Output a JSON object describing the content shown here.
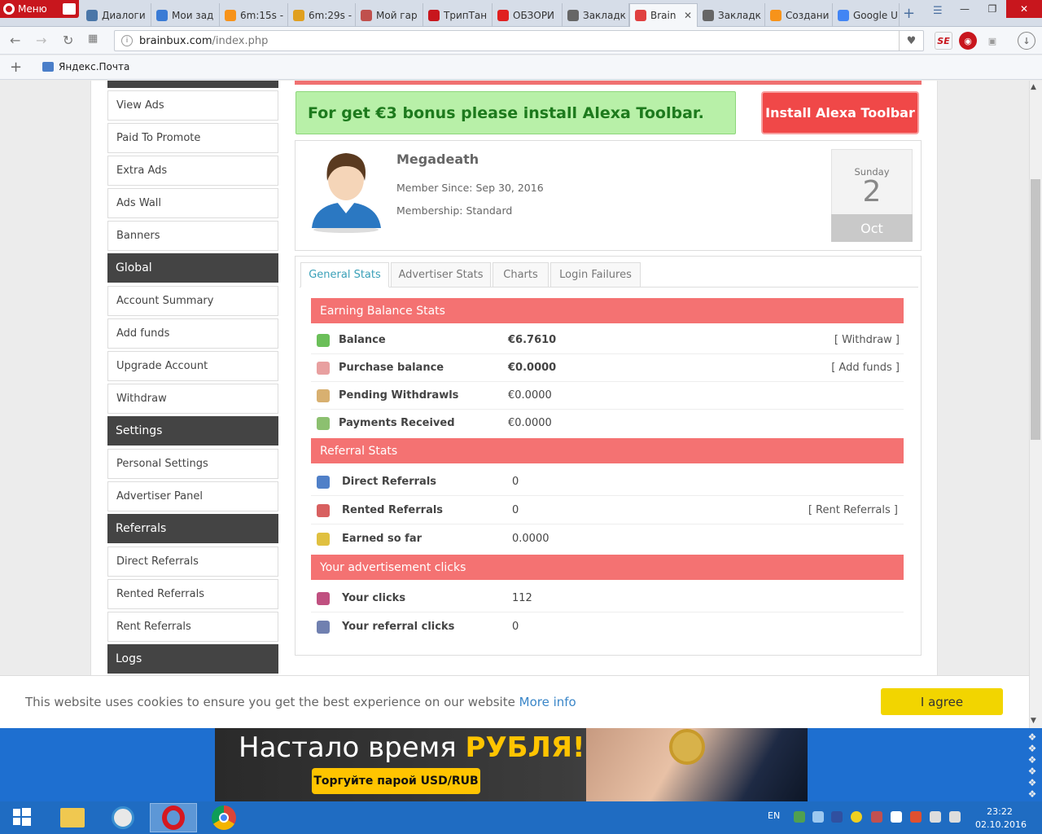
{
  "browser": {
    "menu_label": "Меню",
    "tabs": [
      {
        "label": "Диалоги",
        "color": "#4a76a8"
      },
      {
        "label": "Мои зад",
        "color": "#3a7bd5"
      },
      {
        "label": "6m:15s -",
        "color": "#f7931a"
      },
      {
        "label": "6m:29s -",
        "color": "#e0a020"
      },
      {
        "label": "Мой гар",
        "color": "#c0504d"
      },
      {
        "label": "ТрипТан",
        "color": "#c8161d"
      },
      {
        "label": "ОБЗОРИ",
        "color": "#e02020"
      },
      {
        "label": "Закладк",
        "color": "#666666"
      },
      {
        "label": "Brain",
        "color": "#e04040"
      },
      {
        "label": "Закладк",
        "color": "#666666"
      },
      {
        "label": "Создани",
        "color": "#f7931a"
      },
      {
        "label": "Google U",
        "color": "#4285f4"
      }
    ],
    "url_host": "brainbux.com",
    "url_path": "/index.php",
    "bookmark": "Яндекс.Почта"
  },
  "sidebar": {
    "items_top": [
      "View Ads",
      "Paid To Promote",
      "Extra Ads",
      "Ads Wall",
      "Banners"
    ],
    "global_head": "Global",
    "items_global": [
      "Account Summary",
      "Add funds",
      "Upgrade Account",
      "Withdraw"
    ],
    "settings_head": "Settings",
    "items_settings": [
      "Personal Settings",
      "Advertiser Panel"
    ],
    "referrals_head": "Referrals",
    "items_referrals": [
      "Direct Referrals",
      "Rented Referrals",
      "Rent Referrals"
    ],
    "logs_head": "Logs"
  },
  "alexa": {
    "message": "For get €3 bonus please install Alexa Toolbar.",
    "button": "Install Alexa Toolbar"
  },
  "profile": {
    "username": "Megadeath",
    "member_since": "Member Since: Sep 30, 2016",
    "membership": "Membership: Standard",
    "cal_day": "Sunday",
    "cal_num": "2",
    "cal_month": "Oct"
  },
  "stats_tabs": [
    "General Stats",
    "Advertiser Stats",
    "Charts",
    "Login Failures"
  ],
  "earning": {
    "title": "Earning Balance Stats",
    "rows": [
      {
        "label": "Balance",
        "value": "€6.7610",
        "link": "[ Withdraw ]"
      },
      {
        "label": "Purchase balance",
        "value": "€0.0000",
        "link": "[ Add funds ]"
      },
      {
        "label": "Pending Withdrawls",
        "value": "€0.0000",
        "link": ""
      },
      {
        "label": "Payments Received",
        "value": "€0.0000",
        "link": ""
      }
    ]
  },
  "referral": {
    "title": "Referral Stats",
    "rows": [
      {
        "label": "Direct Referrals",
        "value": "0",
        "link": ""
      },
      {
        "label": "Rented Referrals",
        "value": "0",
        "link": "[ Rent Referrals ]"
      },
      {
        "label": "Earned so far",
        "value": "0.0000",
        "link": ""
      }
    ]
  },
  "clicks": {
    "title": "Your advertisement clicks",
    "rows": [
      {
        "label": "Your clicks",
        "value": "112"
      },
      {
        "label": "Your referral clicks",
        "value": "0"
      }
    ]
  },
  "cookie": {
    "text": "This website uses cookies to ensure you get the best experience on our website",
    "more": "More info",
    "button": "I agree"
  },
  "banner": {
    "title_normal": "Настало время ",
    "title_bold": "РУБЛЯ!",
    "cta": "Торгуйте парой USD/RUB"
  },
  "taskbar": {
    "lang": "EN",
    "time": "23:22",
    "date": "02.10.2016"
  }
}
